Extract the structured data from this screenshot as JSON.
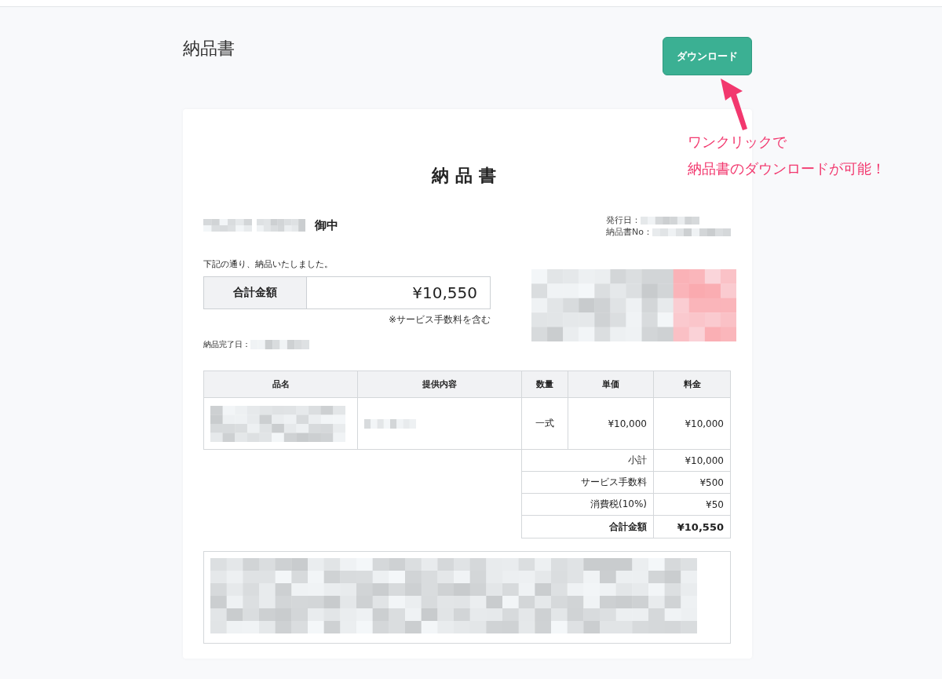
{
  "page": {
    "title": "納品書"
  },
  "download_button": {
    "label": "ダウンロード"
  },
  "annotation": {
    "lines": [
      "ワンクリックで",
      "納品書のダウンロードが可能！"
    ]
  },
  "document": {
    "title": "納品書",
    "recipient_suffix": "御中",
    "meta": [
      {
        "label": "発行日："
      },
      {
        "label": "納品書No："
      }
    ],
    "intro": "下記の通り、納品いたしました。",
    "total": {
      "label": "合計金額",
      "value": "¥10,550"
    },
    "total_note": "※サービス手数料を含む",
    "completion_label": "納品完了日：",
    "table": {
      "columns": [
        "品名",
        "提供内容",
        "数量",
        "単価",
        "料金"
      ],
      "rows": [
        {
          "quantity": "一式",
          "unit_price": "¥10,000",
          "amount": "¥10,000"
        }
      ],
      "summary": [
        {
          "label": "小計",
          "value": "¥10,000",
          "emphasis": false
        },
        {
          "label": "サービス手数料",
          "value": "¥500",
          "emphasis": false
        },
        {
          "label": "消費税(10%)",
          "value": "¥50",
          "emphasis": false
        },
        {
          "label": "合計金額",
          "value": "¥10,550",
          "emphasis": true
        }
      ]
    }
  }
}
